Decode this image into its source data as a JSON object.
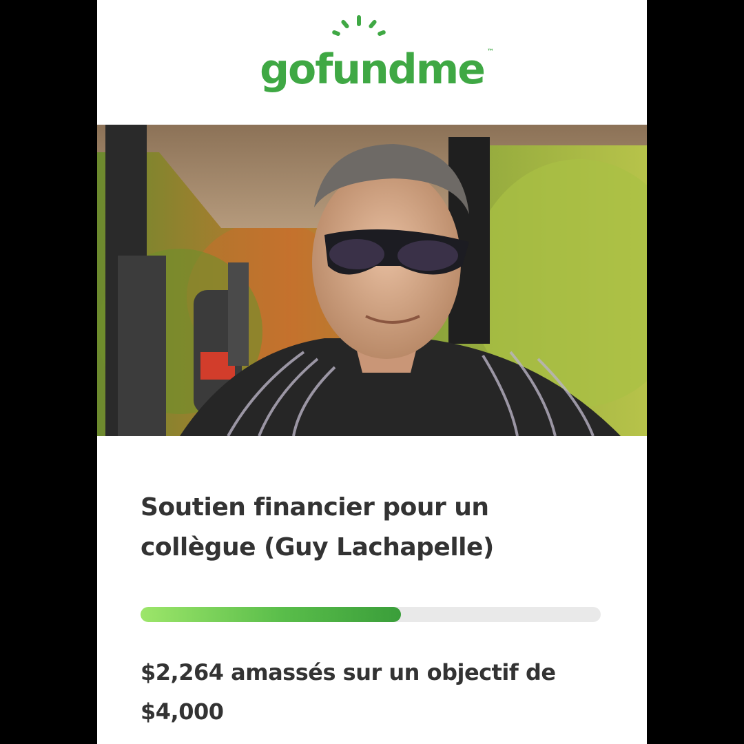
{
  "brand": {
    "logo_text": "gofundme",
    "trademark": "™",
    "color": "#3fa844"
  },
  "campaign": {
    "photo_alt": "Man with sunglasses in a golf cart",
    "title": "Soutien financier pour un collègue (Guy Lachapelle)",
    "raised_amount": "$2,264",
    "raised_text": " amassés sur un objectif de ",
    "goal_amount": "$4,000",
    "progress_fraction": 0.566
  },
  "colors": {
    "page_background": "#000000",
    "card_background": "#ffffff",
    "text": "#333333",
    "progress_track": "#e9e9e9",
    "progress_start": "#9de66a",
    "progress_end": "#3a9e3a"
  },
  "icons": {
    "logo_sun": "sun-rays-icon"
  }
}
